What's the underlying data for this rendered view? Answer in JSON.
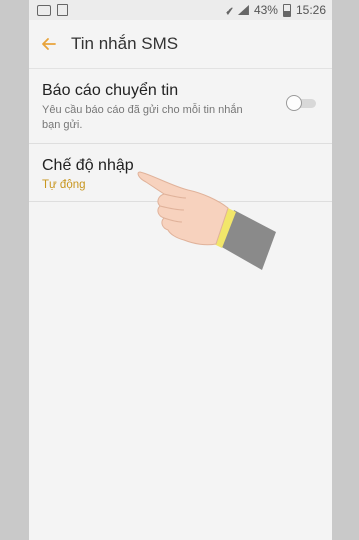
{
  "status_bar": {
    "battery": "43%",
    "time": "15:26",
    "icons": [
      "message-icon",
      "image-icon",
      "wifi-icon",
      "signal-icon",
      "battery-icon"
    ]
  },
  "app_bar": {
    "title": "Tin nhắn SMS",
    "back_icon": "back-arrow-icon",
    "accent_color": "#e8a33a"
  },
  "settings": {
    "delivery_report": {
      "title": "Báo cáo chuyển tin",
      "description": "Yêu cầu báo cáo đã gửi cho mỗi tin nhắn bạn gửi.",
      "enabled": false
    },
    "input_mode": {
      "title": "Chế độ nhập",
      "value": "Tự động",
      "value_color": "#c8961e"
    }
  },
  "overlay": {
    "type": "pointing-hand-illustration"
  }
}
